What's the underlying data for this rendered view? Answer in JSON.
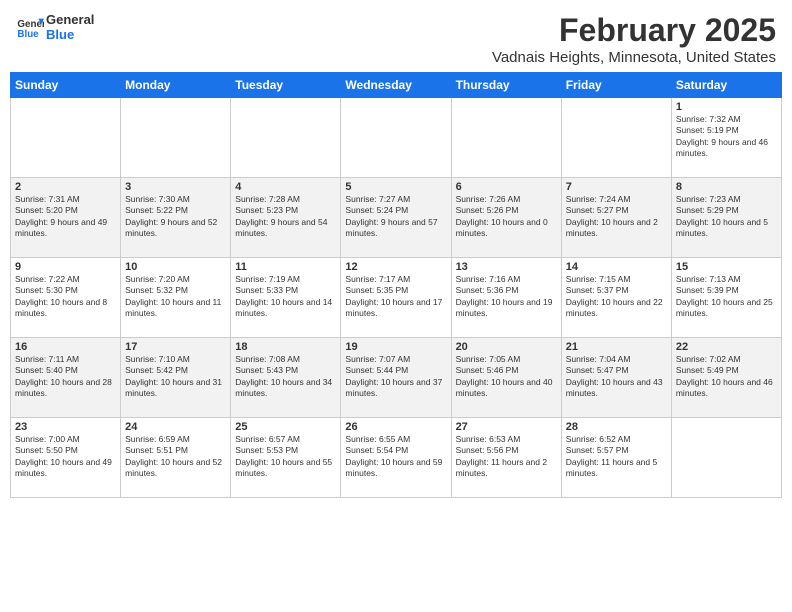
{
  "header": {
    "logo_line1": "General",
    "logo_line2": "Blue",
    "title": "February 2025",
    "subtitle": "Vadnais Heights, Minnesota, United States"
  },
  "days_of_week": [
    "Sunday",
    "Monday",
    "Tuesday",
    "Wednesday",
    "Thursday",
    "Friday",
    "Saturday"
  ],
  "weeks": [
    [
      {
        "day": "",
        "info": ""
      },
      {
        "day": "",
        "info": ""
      },
      {
        "day": "",
        "info": ""
      },
      {
        "day": "",
        "info": ""
      },
      {
        "day": "",
        "info": ""
      },
      {
        "day": "",
        "info": ""
      },
      {
        "day": "1",
        "info": "Sunrise: 7:32 AM\nSunset: 5:19 PM\nDaylight: 9 hours and 46 minutes."
      }
    ],
    [
      {
        "day": "2",
        "info": "Sunrise: 7:31 AM\nSunset: 5:20 PM\nDaylight: 9 hours and 49 minutes."
      },
      {
        "day": "3",
        "info": "Sunrise: 7:30 AM\nSunset: 5:22 PM\nDaylight: 9 hours and 52 minutes."
      },
      {
        "day": "4",
        "info": "Sunrise: 7:28 AM\nSunset: 5:23 PM\nDaylight: 9 hours and 54 minutes."
      },
      {
        "day": "5",
        "info": "Sunrise: 7:27 AM\nSunset: 5:24 PM\nDaylight: 9 hours and 57 minutes."
      },
      {
        "day": "6",
        "info": "Sunrise: 7:26 AM\nSunset: 5:26 PM\nDaylight: 10 hours and 0 minutes."
      },
      {
        "day": "7",
        "info": "Sunrise: 7:24 AM\nSunset: 5:27 PM\nDaylight: 10 hours and 2 minutes."
      },
      {
        "day": "8",
        "info": "Sunrise: 7:23 AM\nSunset: 5:29 PM\nDaylight: 10 hours and 5 minutes."
      }
    ],
    [
      {
        "day": "9",
        "info": "Sunrise: 7:22 AM\nSunset: 5:30 PM\nDaylight: 10 hours and 8 minutes."
      },
      {
        "day": "10",
        "info": "Sunrise: 7:20 AM\nSunset: 5:32 PM\nDaylight: 10 hours and 11 minutes."
      },
      {
        "day": "11",
        "info": "Sunrise: 7:19 AM\nSunset: 5:33 PM\nDaylight: 10 hours and 14 minutes."
      },
      {
        "day": "12",
        "info": "Sunrise: 7:17 AM\nSunset: 5:35 PM\nDaylight: 10 hours and 17 minutes."
      },
      {
        "day": "13",
        "info": "Sunrise: 7:16 AM\nSunset: 5:36 PM\nDaylight: 10 hours and 19 minutes."
      },
      {
        "day": "14",
        "info": "Sunrise: 7:15 AM\nSunset: 5:37 PM\nDaylight: 10 hours and 22 minutes."
      },
      {
        "day": "15",
        "info": "Sunrise: 7:13 AM\nSunset: 5:39 PM\nDaylight: 10 hours and 25 minutes."
      }
    ],
    [
      {
        "day": "16",
        "info": "Sunrise: 7:11 AM\nSunset: 5:40 PM\nDaylight: 10 hours and 28 minutes."
      },
      {
        "day": "17",
        "info": "Sunrise: 7:10 AM\nSunset: 5:42 PM\nDaylight: 10 hours and 31 minutes."
      },
      {
        "day": "18",
        "info": "Sunrise: 7:08 AM\nSunset: 5:43 PM\nDaylight: 10 hours and 34 minutes."
      },
      {
        "day": "19",
        "info": "Sunrise: 7:07 AM\nSunset: 5:44 PM\nDaylight: 10 hours and 37 minutes."
      },
      {
        "day": "20",
        "info": "Sunrise: 7:05 AM\nSunset: 5:46 PM\nDaylight: 10 hours and 40 minutes."
      },
      {
        "day": "21",
        "info": "Sunrise: 7:04 AM\nSunset: 5:47 PM\nDaylight: 10 hours and 43 minutes."
      },
      {
        "day": "22",
        "info": "Sunrise: 7:02 AM\nSunset: 5:49 PM\nDaylight: 10 hours and 46 minutes."
      }
    ],
    [
      {
        "day": "23",
        "info": "Sunrise: 7:00 AM\nSunset: 5:50 PM\nDaylight: 10 hours and 49 minutes."
      },
      {
        "day": "24",
        "info": "Sunrise: 6:59 AM\nSunset: 5:51 PM\nDaylight: 10 hours and 52 minutes."
      },
      {
        "day": "25",
        "info": "Sunrise: 6:57 AM\nSunset: 5:53 PM\nDaylight: 10 hours and 55 minutes."
      },
      {
        "day": "26",
        "info": "Sunrise: 6:55 AM\nSunset: 5:54 PM\nDaylight: 10 hours and 59 minutes."
      },
      {
        "day": "27",
        "info": "Sunrise: 6:53 AM\nSunset: 5:56 PM\nDaylight: 11 hours and 2 minutes."
      },
      {
        "day": "28",
        "info": "Sunrise: 6:52 AM\nSunset: 5:57 PM\nDaylight: 11 hours and 5 minutes."
      },
      {
        "day": "",
        "info": ""
      }
    ]
  ]
}
